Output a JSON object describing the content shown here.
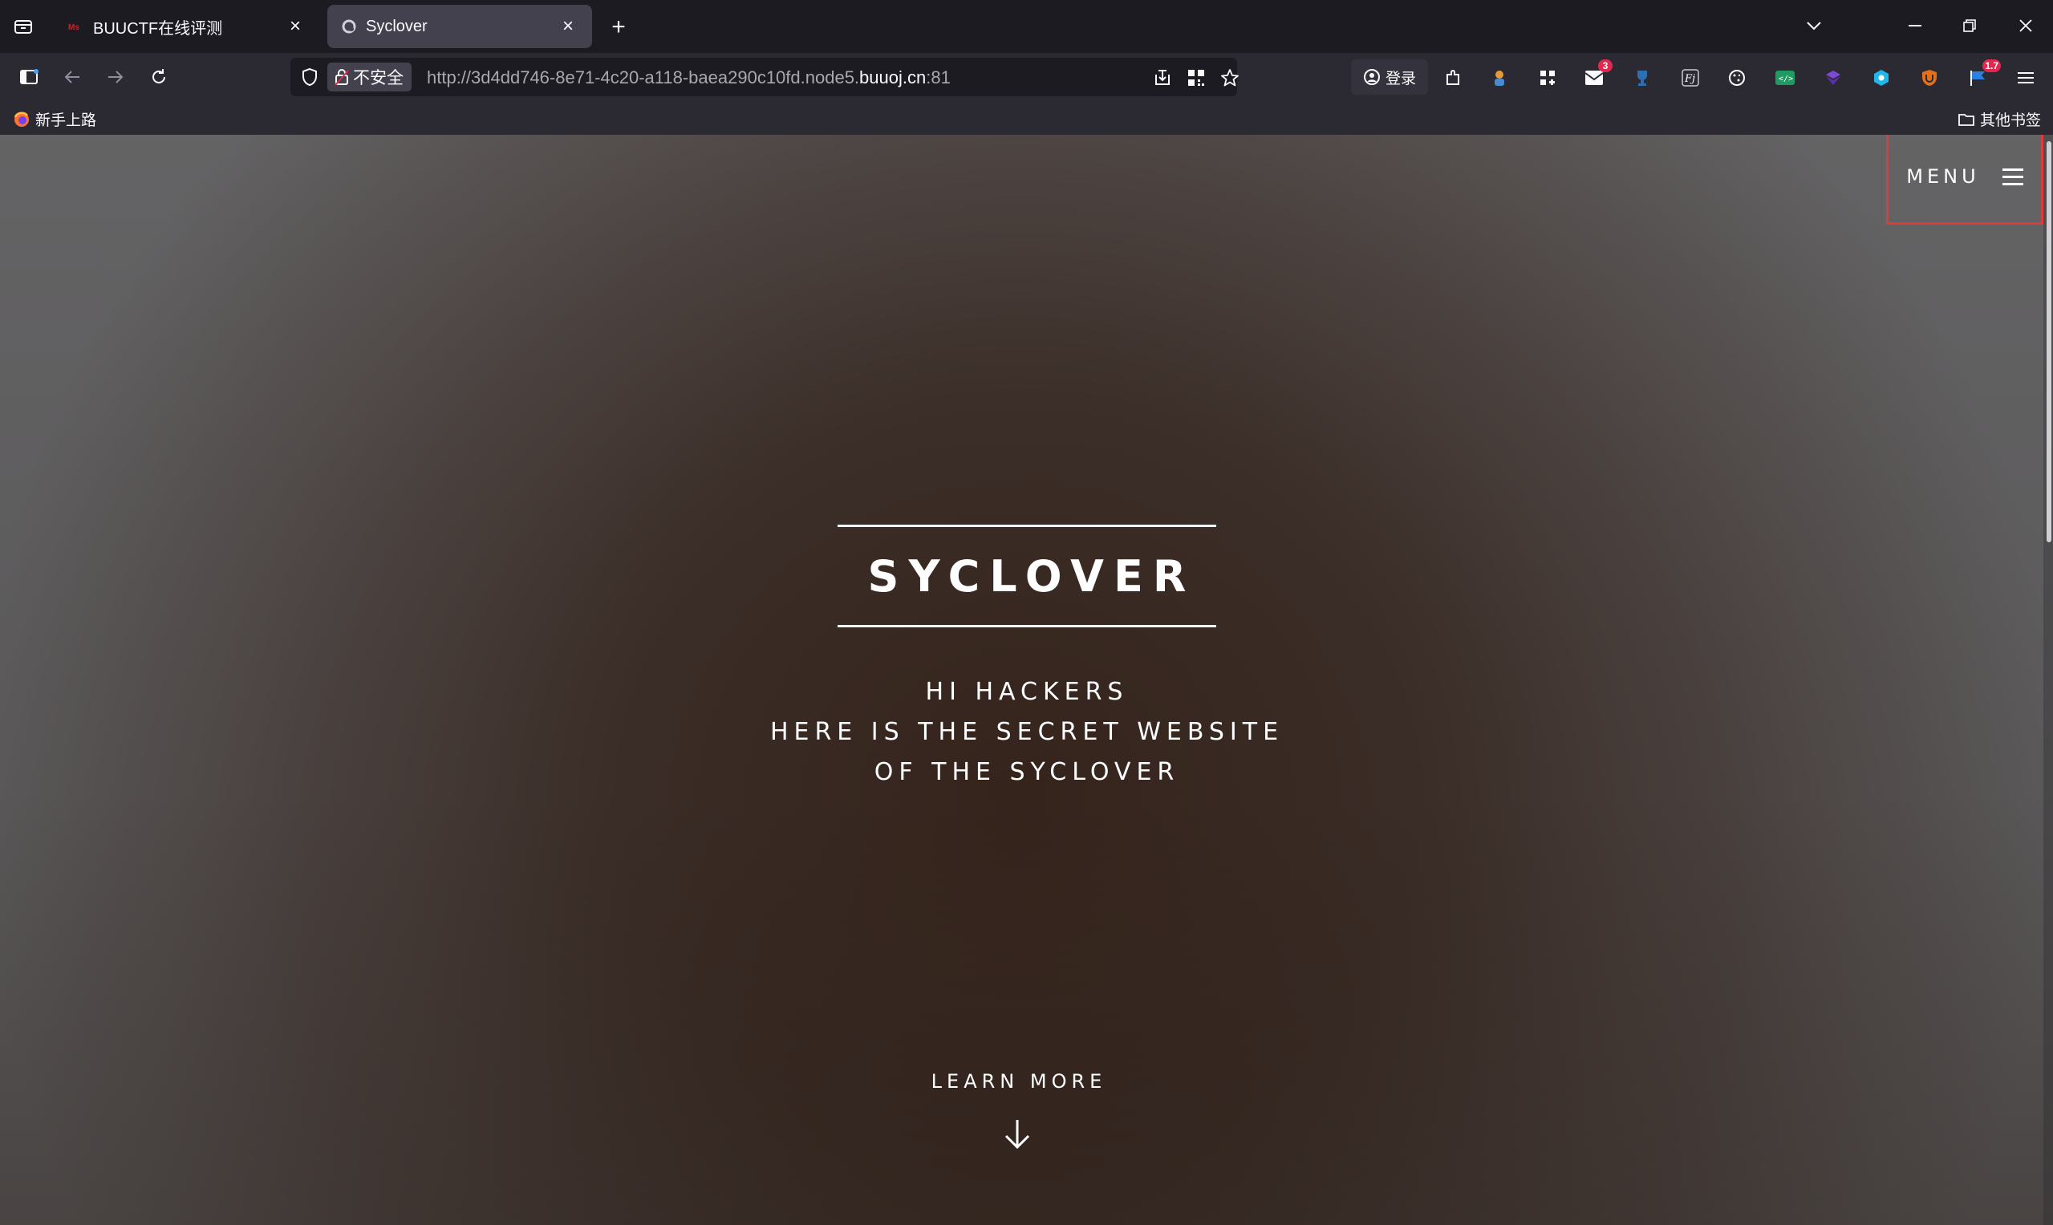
{
  "browser": {
    "tabs": [
      {
        "title": "BUUCTF在线评测",
        "active": false
      },
      {
        "title": "Syclover",
        "active": true
      }
    ],
    "url": {
      "prefix": "http://3d4dd746-8e71-4c20-a118-baea290c10fd.node5.",
      "host": "buuoj.cn",
      "suffix": ":81"
    },
    "security_label": "不安全",
    "login_label": "登录",
    "extension_badges": {
      "mail": "3",
      "flag": "1.7"
    },
    "bookmarks": {
      "left": "新手上路",
      "right": "其他书签"
    }
  },
  "page": {
    "menu_label": "MENU",
    "brand": "SYCLOVER",
    "tagline": [
      "HI HACKERS",
      "HERE IS THE SECRET WEBSITE",
      "OF THE SYCLOVER"
    ],
    "learn_more": "LEARN MORE"
  },
  "colors": {
    "highlight_box": "#e23a3a",
    "chrome_bg": "#1c1b22",
    "toolbar_bg": "#2b2a33"
  }
}
